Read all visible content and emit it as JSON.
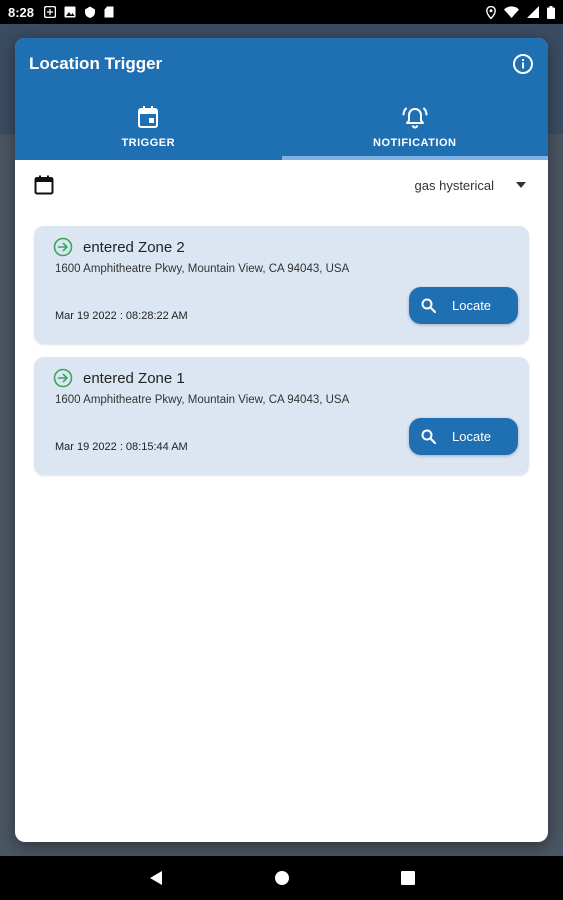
{
  "status_bar": {
    "time": "8:28",
    "left_icons": [
      "notification-icon",
      "image-icon",
      "shield-icon",
      "sd-card-icon"
    ],
    "right_icons": [
      "location-icon",
      "wifi-icon",
      "signal-icon",
      "battery-icon"
    ]
  },
  "dialog": {
    "title": "Location Trigger",
    "info_icon": "info-icon"
  },
  "tabs": [
    {
      "label": "TRIGGER",
      "icon": "calendar-icon",
      "selected": false
    },
    {
      "label": "NOTIFICATION",
      "icon": "bell-alarm-icon",
      "selected": true
    }
  ],
  "filter": {
    "calendar_icon": "calendar-icon",
    "device_selected": "gas hysterical"
  },
  "notifications": [
    {
      "title": "entered Zone 2",
      "address": "1600 Amphitheatre Pkwy, Mountain View, CA 94043, USA",
      "time": "Mar 19 2022 : 08:28:22 AM",
      "button_label": "Locate"
    },
    {
      "title": "entered Zone 1",
      "address": "1600 Amphitheatre Pkwy, Mountain View, CA 94043, USA",
      "time": "Mar 19 2022 : 08:15:44 AM",
      "button_label": "Locate"
    }
  ],
  "colors": {
    "primary": "#1f6fb3",
    "card_background": "#dce6f3",
    "tab_indicator": "#7fb2e6",
    "enter_icon": "#3aa65a"
  }
}
